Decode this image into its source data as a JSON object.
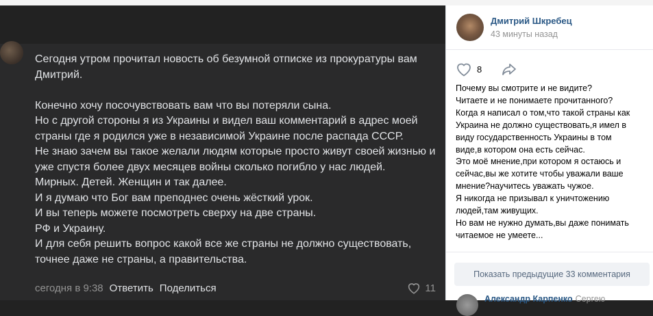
{
  "comment": {
    "paragraphs": [
      "Сегодня утром прочитал новость об безумной отписке из прокуратуры вам Дмитрий.",
      "",
      "Конечно хочу посочувствовать вам что вы потеряли сына.",
      "Но с другой стороны я из Украины и видел ваш комментарий в адрес моей страны где я родился уже в независимой Украине после распада СССР.",
      "Не знаю зачем вы такое желали людям которые просто живут своей жизнью и уже спустя более двух месяцев войны сколько погибло у нас людей.",
      "Мирных. Детей. Женщин и так далее.",
      "И я думаю что Бог вам преподнес очень жёсткий урок.",
      "И вы теперь можете посмотреть сверху на две страны.",
      "РФ и Украину.",
      "И для себя решить вопрос какой все же страны не должно существовать, точнее даже не страны, а правительства."
    ],
    "timestamp": "сегодня в 9:38",
    "reply_label": "Ответить",
    "share_label": "Поделиться",
    "like_count": "11"
  },
  "sidebar": {
    "author": "Дмитрий Шкребец",
    "time": "43 минуты назад",
    "like_count": "8",
    "text_lines": [
      "Почему вы смотрите и не видите?",
      "Читаете и не понимаете прочитанного?",
      "Когда я написал о том,что такой страны как",
      "Украина не должно существовать,я имел в",
      "виду государственность Украины в том",
      "виде,в котором она есть сейчас.",
      "Это моё мнение,при котором я остаюсь и",
      "сейчас,вы же хотите чтобы уважали ваше",
      "мнение?научитесь уважать чужое.",
      "Я никогда не призывал к уничтожению",
      "людей,там живущих.",
      "Но вам не нужно думать,вы даже понимать",
      "читаемое не умеете..."
    ],
    "show_prev_label": "Показать предыдущие 33 комментария",
    "next_comment_author": "Александр Карпенко",
    "next_comment_reply_to": "Сергею"
  }
}
